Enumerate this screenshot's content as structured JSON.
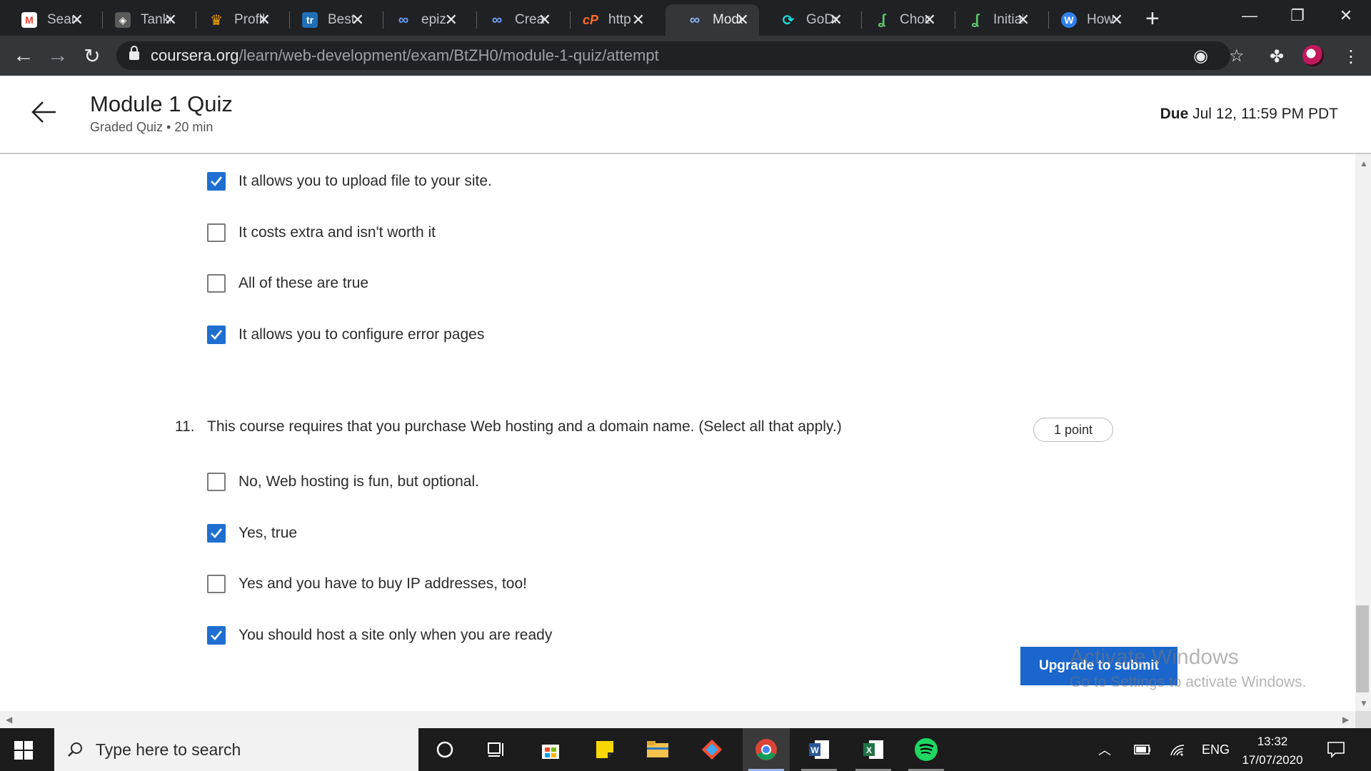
{
  "browser": {
    "tabs": [
      {
        "title": "Search",
        "icon": "gmail-icon",
        "color": "#ea4335"
      },
      {
        "title": "Tanki",
        "icon": "tanki-icon",
        "color": "#6d6d6d"
      },
      {
        "title": "Profile",
        "icon": "crown-icon",
        "color": "#f4a300"
      },
      {
        "title": "Best",
        "icon": "tr-icon",
        "color": "#1f6fb5"
      },
      {
        "title": "epiz",
        "icon": "infinity-icon",
        "color": "#4a7bd8"
      },
      {
        "title": "Create",
        "icon": "infinity-icon",
        "color": "#4a7bd8"
      },
      {
        "title": "http",
        "icon": "cpanel-icon",
        "color": "#ff6c2c"
      },
      {
        "title": "Module",
        "icon": "infinity-icon",
        "color": "#8ab4f8",
        "active": true
      },
      {
        "title": "GoDaddy",
        "icon": "godaddy-icon",
        "color": "#1bdbdb"
      },
      {
        "title": "Choose",
        "icon": "leaf-icon",
        "color": "#5ec16b"
      },
      {
        "title": "Initial",
        "icon": "leaf-icon",
        "color": "#5ec16b"
      },
      {
        "title": "How",
        "icon": "w-icon",
        "color": "#2f80ed"
      }
    ],
    "url_host": "coursera.org",
    "url_path": "/learn/web-development/exam/BtZH0/module-1-quiz/attempt"
  },
  "header": {
    "title": "Module 1 Quiz",
    "subtitle": "Graded Quiz • 20 min",
    "due_label": "Due",
    "due_value": "Jul 12, 11:59 PM PDT"
  },
  "question10_options": [
    {
      "label": "It allows you to upload file to your site.",
      "checked": true
    },
    {
      "label": "It costs extra and isn't worth it",
      "checked": false
    },
    {
      "label": "All of these are true",
      "checked": false
    },
    {
      "label": "It allows you to configure error pages",
      "checked": true
    }
  ],
  "question11": {
    "number": "11.",
    "text": "This course requires that you purchase Web hosting and a domain name. (Select all that apply.)",
    "points": "1 point",
    "options": [
      {
        "label": "No, Web hosting is fun, but optional.",
        "checked": false
      },
      {
        "label": "Yes, true",
        "checked": true
      },
      {
        "label": "Yes and you have to buy IP addresses, too!",
        "checked": false
      },
      {
        "label": "You should host a site only when you are ready",
        "checked": true
      }
    ]
  },
  "footer": {
    "submit_label": "Upgrade to submit"
  },
  "watermark": {
    "line1": "Activate Windows",
    "line2": "Go to Settings to activate Windows."
  },
  "taskbar": {
    "search_placeholder": "Type here to search",
    "language": "ENG",
    "time": "13:32",
    "date": "17/07/2020"
  },
  "colors": {
    "accent": "#1f6fd0",
    "submit": "#1a66cc",
    "chrome_dark": "#202124"
  }
}
